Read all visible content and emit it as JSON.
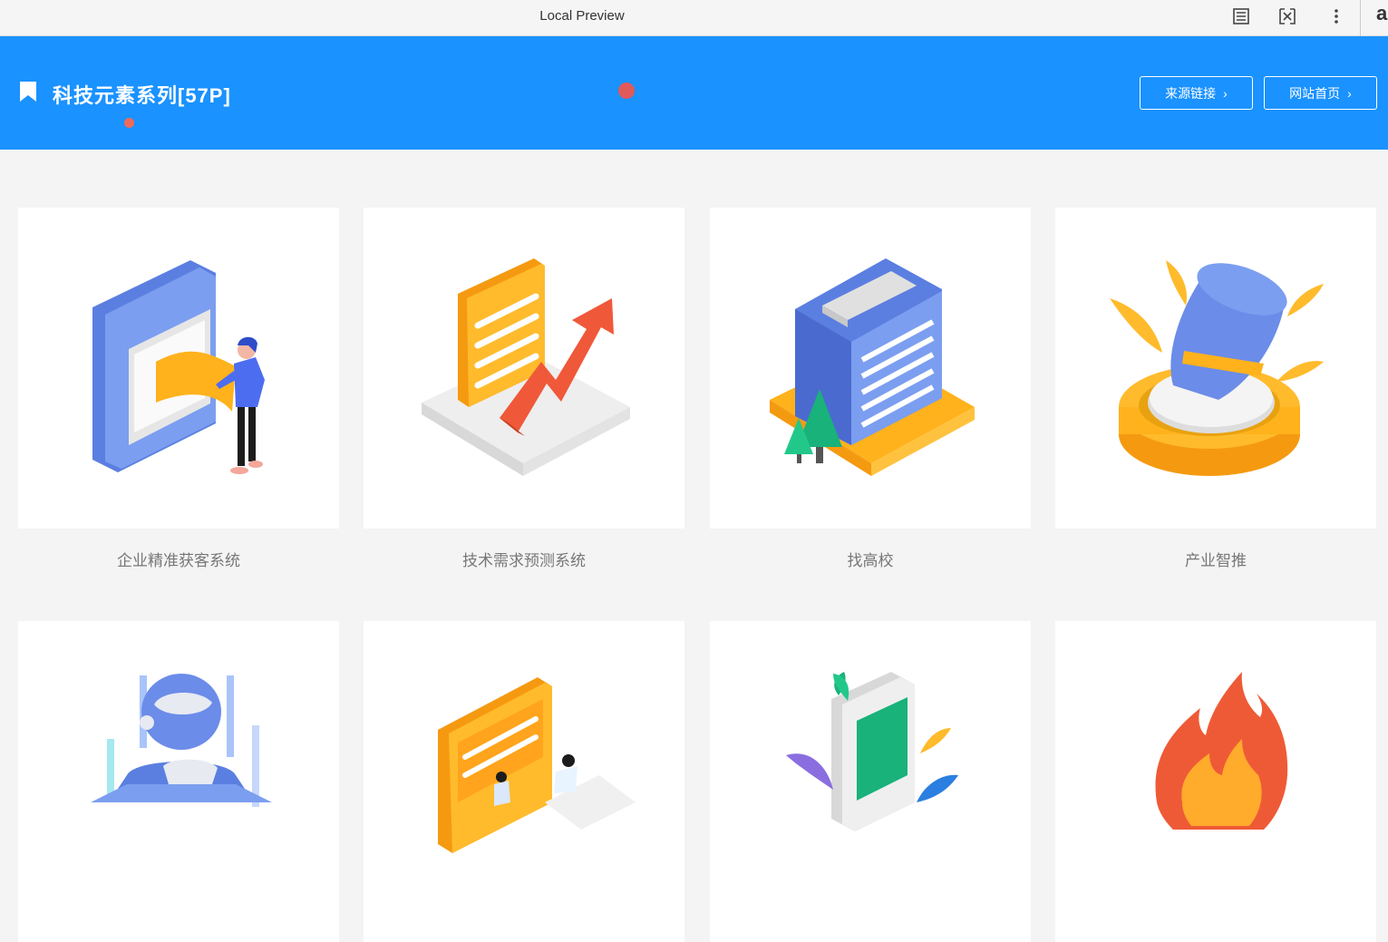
{
  "browser": {
    "title": "Local Preview",
    "icons": [
      "reader-icon",
      "extension-icon",
      "more-menu-icon"
    ],
    "profile_letter": "a"
  },
  "header": {
    "title": "科技元素系列[57P]",
    "bookmark_icon": "bookmark-icon",
    "background_color": "#1a92ff",
    "buttons": [
      {
        "label": "来源链接"
      },
      {
        "label": "网站首页"
      }
    ]
  },
  "grid": {
    "items": [
      {
        "caption": "企业精准获客系统",
        "illustration": "tablet-person-illustration"
      },
      {
        "caption": "技术需求预测系统",
        "illustration": "document-growth-arrow-illustration"
      },
      {
        "caption": "找高校",
        "illustration": "building-trees-illustration"
      },
      {
        "caption": "产业智推",
        "illustration": "spotlight-splash-illustration"
      },
      {
        "caption": "",
        "illustration": "robot-illustration"
      },
      {
        "caption": "",
        "illustration": "document-people-illustration"
      },
      {
        "caption": "",
        "illustration": "phone-splash-illustration"
      },
      {
        "caption": "",
        "illustration": "flame-illustration"
      }
    ]
  }
}
